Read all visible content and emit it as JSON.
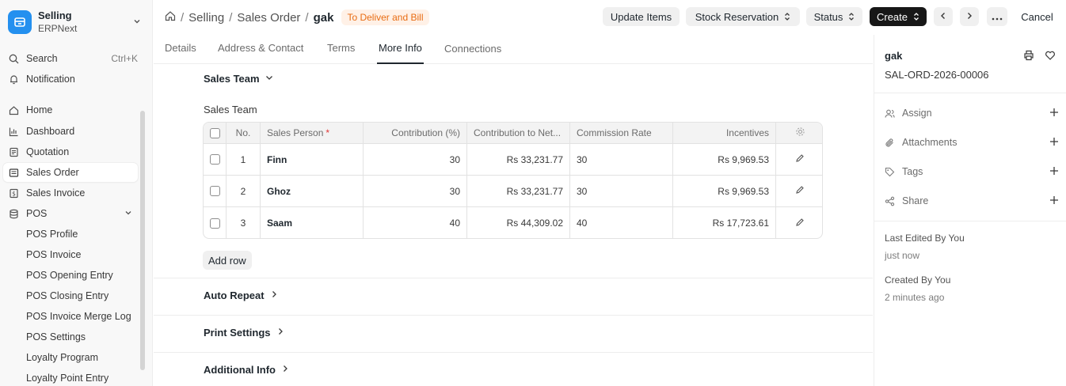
{
  "app": {
    "name": "Selling",
    "sub": "ERPNext"
  },
  "sidebar": {
    "search_label": "Search",
    "search_shortcut": "Ctrl+K",
    "notification_label": "Notification",
    "items": [
      {
        "label": "Home",
        "icon": "home-icon"
      },
      {
        "label": "Dashboard",
        "icon": "bar-chart-icon"
      },
      {
        "label": "Quotation",
        "icon": "document-icon"
      },
      {
        "label": "Sales Order",
        "icon": "list-icon",
        "active": true
      },
      {
        "label": "Sales Invoice",
        "icon": "invoice-icon"
      },
      {
        "label": "POS",
        "icon": "database-icon",
        "expanded": true
      }
    ],
    "pos_children": [
      "POS Profile",
      "POS Invoice",
      "POS Opening Entry",
      "POS Closing Entry",
      "POS Invoice Merge Log",
      "POS Settings",
      "Loyalty Program",
      "Loyalty Point Entry"
    ]
  },
  "header": {
    "breadcrumb": [
      "Selling",
      "Sales Order"
    ],
    "doc_title": "gak",
    "status": "To Deliver and Bill",
    "update_items": "Update Items",
    "stock_reservation": "Stock Reservation",
    "status_btn": "Status",
    "create": "Create",
    "cancel": "Cancel"
  },
  "tabs": [
    "Details",
    "Address & Contact",
    "Terms",
    "More Info",
    "Connections"
  ],
  "active_tab": "More Info",
  "main": {
    "sales_team_section": "Sales Team",
    "sales_team_field": "Sales Team",
    "columns": {
      "no": "No.",
      "sales_person": "Sales Person",
      "required_mark": "*",
      "contribution": "Contribution (%)",
      "contribution_net": "Contribution to Net...",
      "commission_rate": "Commission Rate",
      "incentives": "Incentives"
    },
    "rows": [
      {
        "no": "1",
        "sales_person": "Finn",
        "contribution": "30",
        "contribution_net": "Rs 33,231.77",
        "commission_rate": "30",
        "incentives": "Rs 9,969.53"
      },
      {
        "no": "2",
        "sales_person": "Ghoz",
        "contribution": "30",
        "contribution_net": "Rs 33,231.77",
        "commission_rate": "30",
        "incentives": "Rs 9,969.53"
      },
      {
        "no": "3",
        "sales_person": "Saam",
        "contribution": "40",
        "contribution_net": "Rs 44,309.02",
        "commission_rate": "40",
        "incentives": "Rs 17,723.61"
      }
    ],
    "add_row": "Add row",
    "auto_repeat": "Auto Repeat",
    "print_settings": "Print Settings",
    "additional_info": "Additional Info"
  },
  "right_panel": {
    "title": "gak",
    "name": "SAL-ORD-2026-00006",
    "assign": "Assign",
    "attachments": "Attachments",
    "tags": "Tags",
    "share": "Share",
    "last_edited": "Last Edited By You",
    "last_edited_time": "just now",
    "created": "Created By You",
    "created_time": "2 minutes ago"
  },
  "colors": {
    "brand": "#2490ef",
    "status_bg": "#fff1e7",
    "status_fg": "#e86c13",
    "dark_button": "#171717"
  }
}
